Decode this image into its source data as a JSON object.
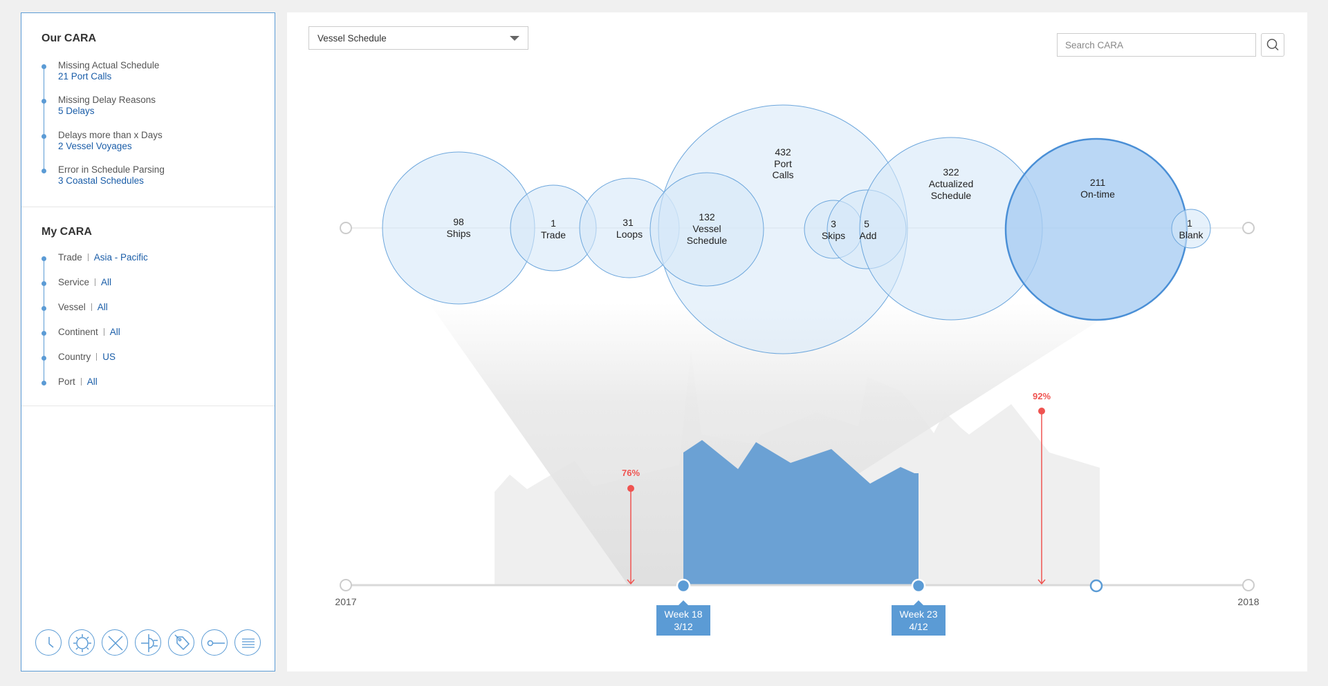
{
  "our_cara": {
    "title": "Our CARA",
    "items": [
      {
        "label": "Missing Actual Schedule",
        "value": "21 Port Calls"
      },
      {
        "label": "Missing Delay Reasons",
        "value": "5 Delays"
      },
      {
        "label": "Delays more than x Days",
        "value": "2 Vessel Voyages"
      },
      {
        "label": "Error in Schedule Parsing",
        "value": "3 Coastal Schedules"
      }
    ]
  },
  "my_cara": {
    "title": "My CARA",
    "filters": [
      {
        "label": "Trade",
        "value": "Asia - Pacific"
      },
      {
        "label": "Service",
        "value": "All"
      },
      {
        "label": "Vessel",
        "value": "All"
      },
      {
        "label": "Continent",
        "value": "All"
      },
      {
        "label": "Country",
        "value": "US"
      },
      {
        "label": "Port",
        "value": "All"
      }
    ]
  },
  "toolbar_icons": [
    "clock-icon",
    "sun-icon",
    "close-x-icon",
    "plug-icon",
    "tag-icon",
    "key-icon",
    "list-icon"
  ],
  "view_select": {
    "value": "Vessel Schedule"
  },
  "search": {
    "placeholder": "Search CARA"
  },
  "bubbles": [
    {
      "value": "98",
      "lines": [
        "Ships"
      ]
    },
    {
      "value": "1",
      "lines": [
        "Trade"
      ]
    },
    {
      "value": "31",
      "lines": [
        "Loops"
      ]
    },
    {
      "value": "132",
      "lines": [
        "Vessel",
        "Schedule"
      ]
    },
    {
      "value": "432",
      "lines": [
        "Port",
        "Calls"
      ]
    },
    {
      "value": "3",
      "lines": [
        "Skips"
      ]
    },
    {
      "value": "5",
      "lines": [
        "Add"
      ]
    },
    {
      "value": "322",
      "lines": [
        "Actualized",
        "Schedule"
      ]
    },
    {
      "value": "211",
      "lines": [
        "On-time"
      ]
    },
    {
      "value": "1",
      "lines": [
        "Blank"
      ]
    }
  ],
  "timeline": {
    "start_label": "2017",
    "end_label": "2018",
    "markers": [
      {
        "label": "76%",
        "value": 76
      },
      {
        "label": "92%",
        "value": 92
      }
    ],
    "selection": {
      "start": {
        "week": "Week 18",
        "date": "3/12"
      },
      "end": {
        "week": "Week 23",
        "date": "4/12"
      }
    }
  },
  "colors": {
    "accent": "#5b9bd5",
    "link": "#1a5da8",
    "alert": "#ef5350",
    "bubble_fill": "#d6e7f8",
    "selected_area": "#6ba1d4"
  }
}
